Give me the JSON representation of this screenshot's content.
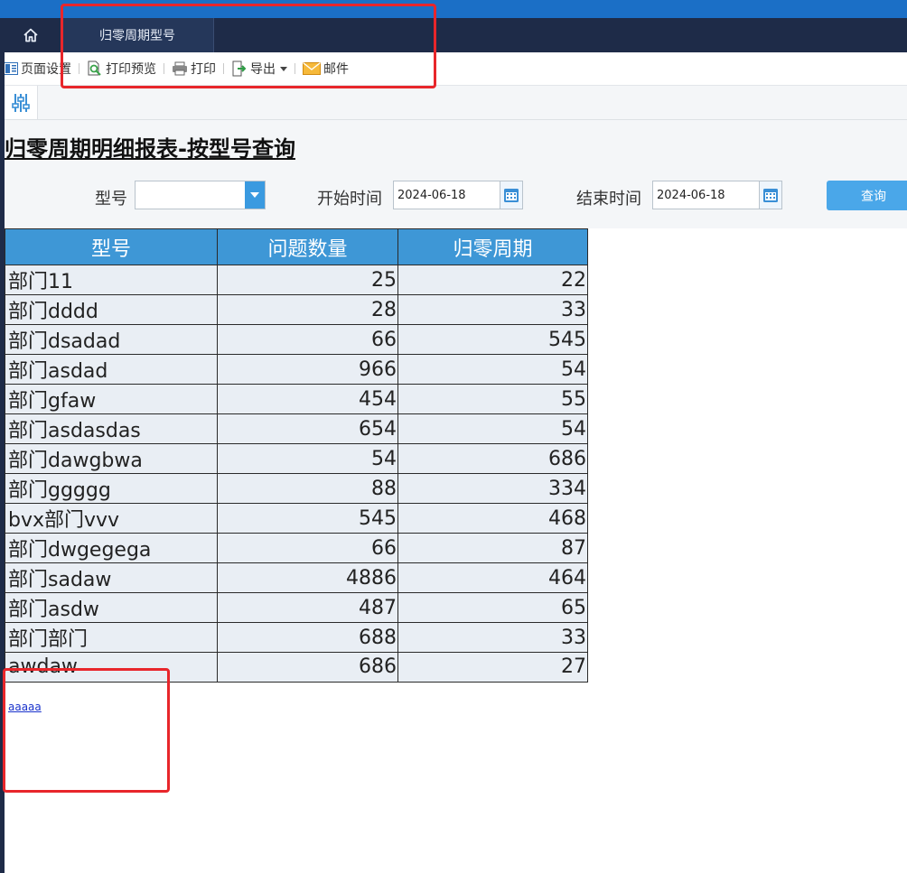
{
  "tabs": {
    "active_label": "归零周期型号"
  },
  "toolbar": {
    "page_setup": "页面设置",
    "print_preview": "打印预览",
    "print": "打印",
    "export": "导出",
    "mail": "邮件"
  },
  "report": {
    "title": "归零周期明细报表-按型号查询"
  },
  "filters": {
    "model_label": "型号",
    "model_value": "",
    "start_label": "开始时间",
    "start_value": "2024-06-18",
    "end_label": "结束时间",
    "end_value": "2024-06-18",
    "query_label": "查询"
  },
  "table": {
    "headers": [
      "型号",
      "问题数量",
      "归零周期"
    ],
    "rows": [
      [
        "部门11",
        "25",
        "22"
      ],
      [
        "部门dddd",
        "28",
        "33"
      ],
      [
        "部门dsadad",
        "66",
        "545"
      ],
      [
        "部门asdad",
        "966",
        "54"
      ],
      [
        "部门gfaw",
        "454",
        "55"
      ],
      [
        "部门asdasdas",
        "654",
        "54"
      ],
      [
        "部门dawgbwa",
        "54",
        "686"
      ],
      [
        "部门ggggg",
        "88",
        "334"
      ],
      [
        "bvx部门vvv",
        "545",
        "468"
      ],
      [
        "部门dwgegega",
        "66",
        "87"
      ],
      [
        "部门sadaw",
        "4886",
        "464"
      ],
      [
        "部门asdw",
        "487",
        "65"
      ],
      [
        "部门部门",
        "688",
        "33"
      ],
      [
        "awdaw",
        "686",
        "27"
      ]
    ]
  },
  "footer": {
    "link_text": "aaaaa"
  },
  "colors": {
    "top_bar": "#1b6fc6",
    "tab_bar": "#1e2b48",
    "header_blue": "#3e97d6",
    "row_bg": "#e9eef4",
    "highlight_red": "#e8262b"
  }
}
